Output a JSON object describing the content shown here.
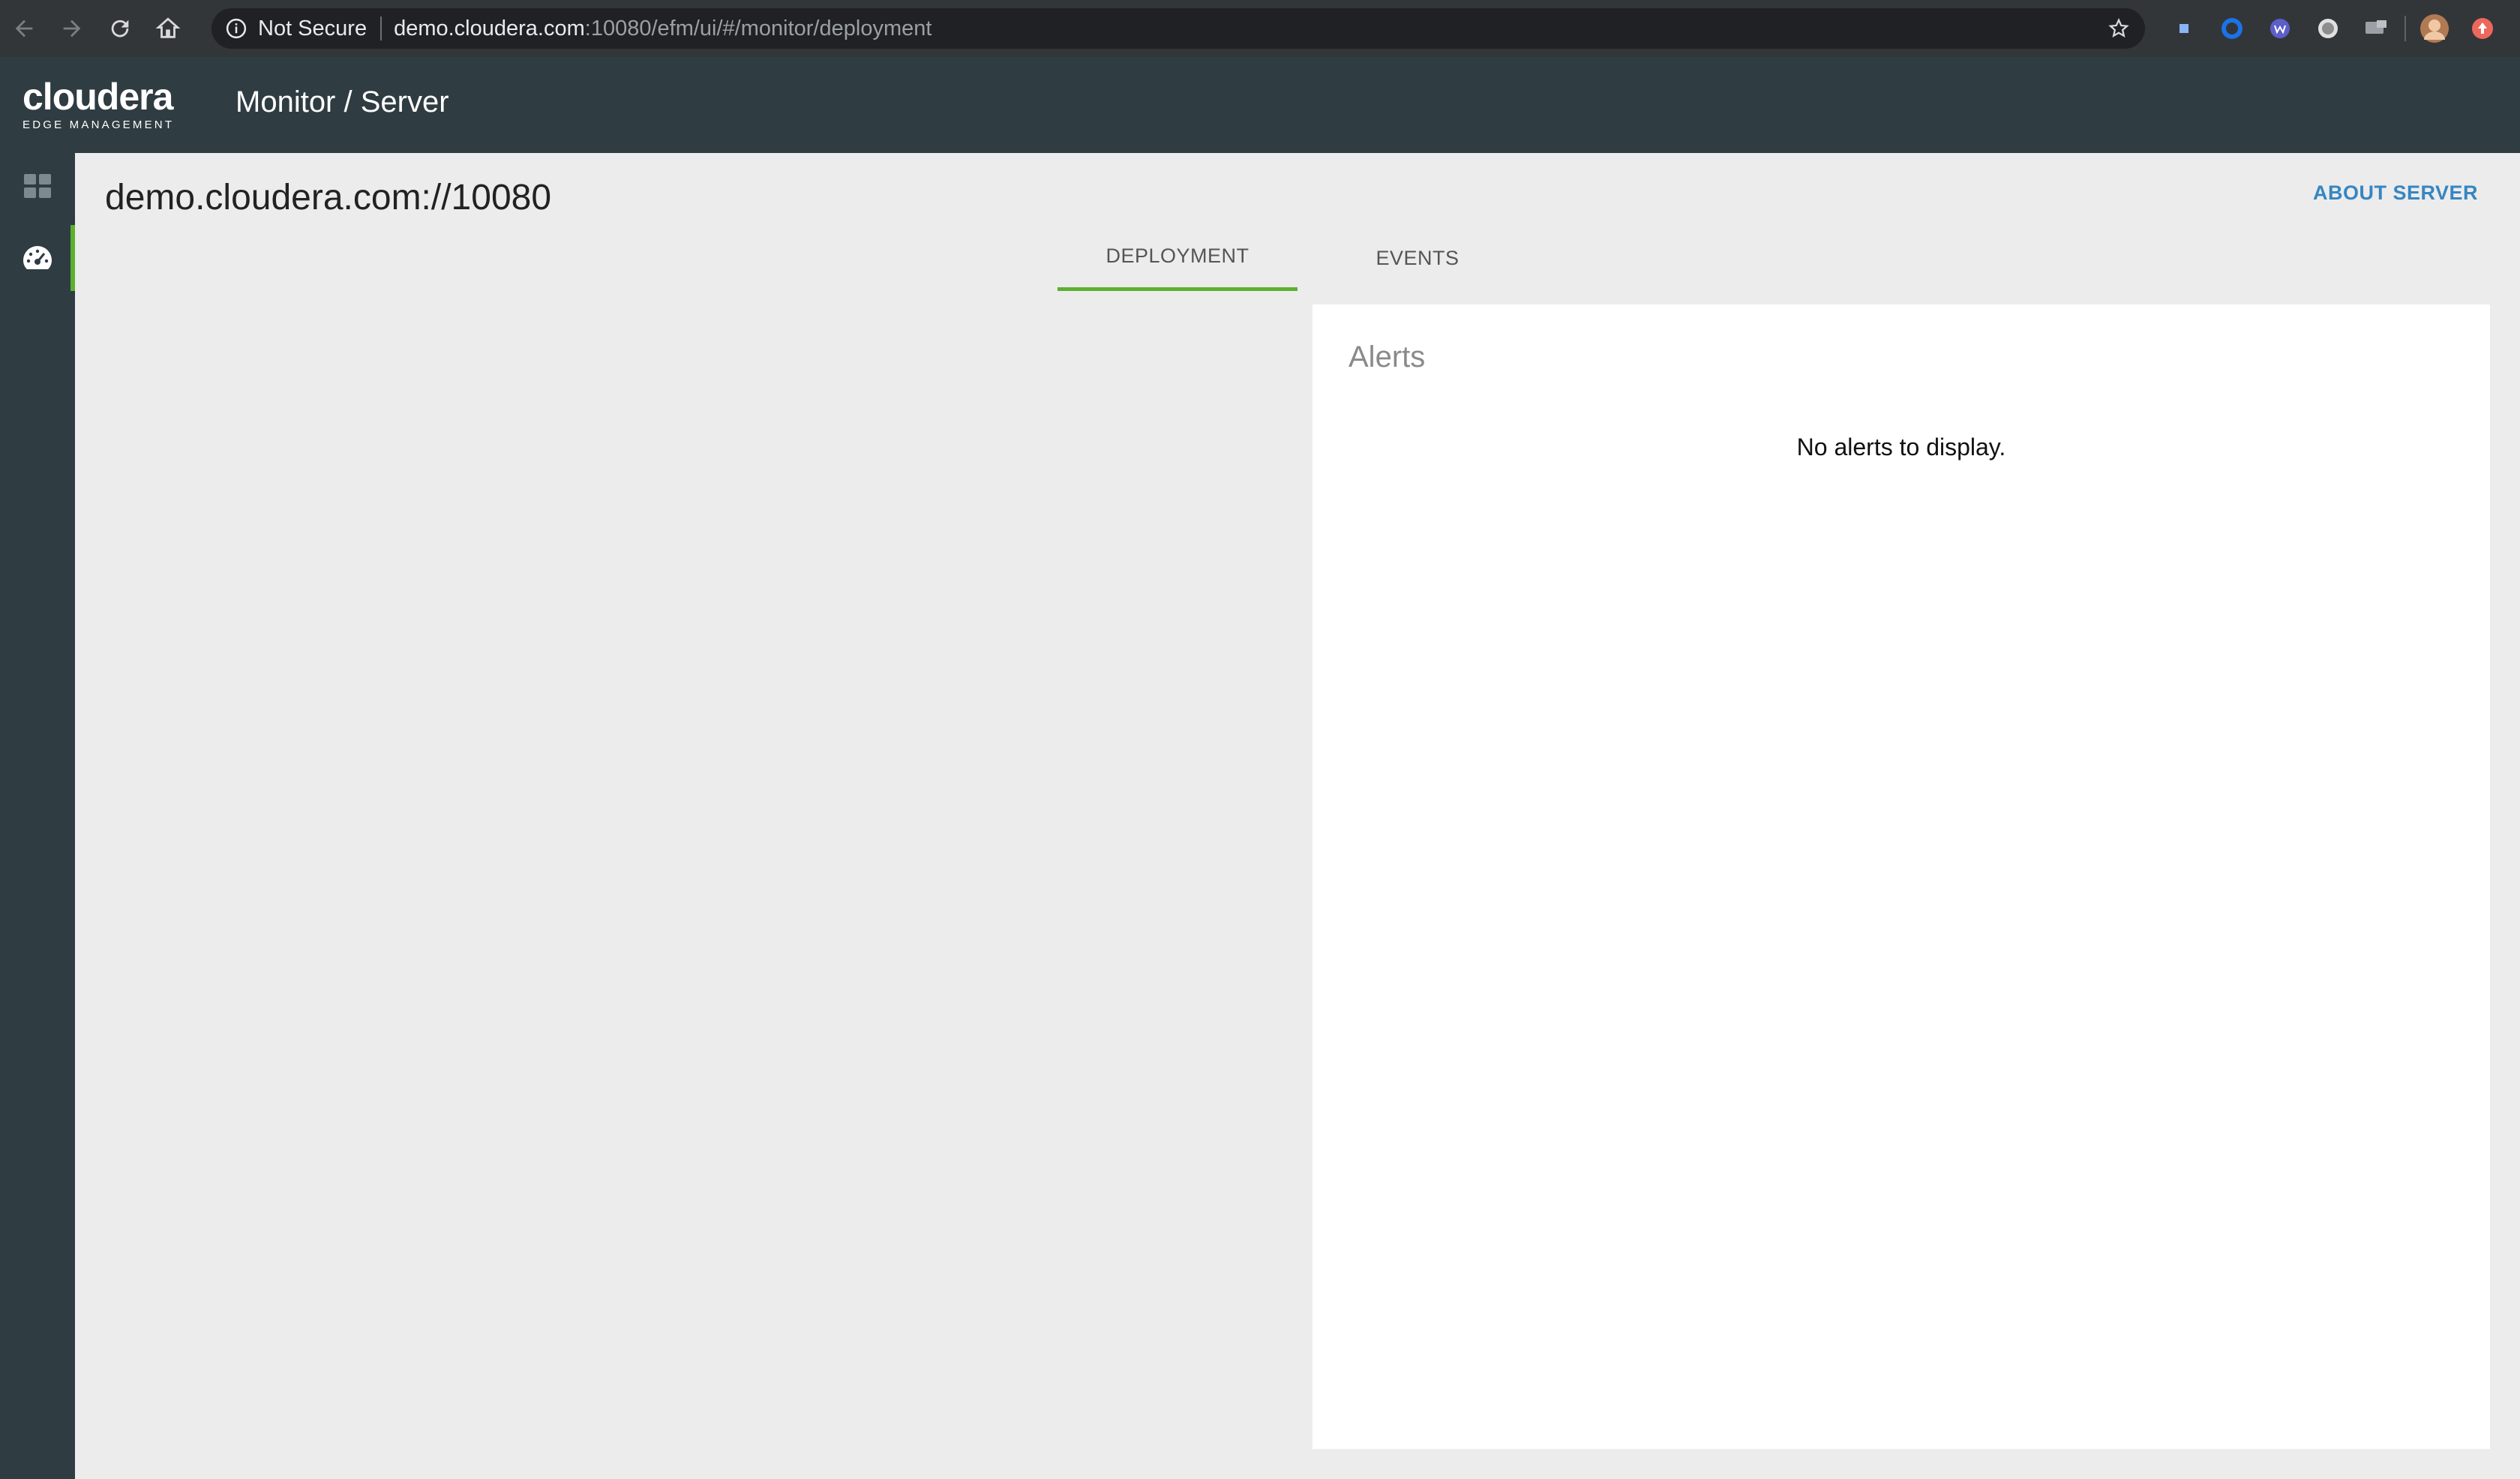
{
  "browser": {
    "security_label": "Not Secure",
    "url_host": "demo.cloudera.com",
    "url_rest": ":10080/efm/ui/#/monitor/deployment",
    "nav_icons": [
      "back-arrow-icon",
      "forward-arrow-icon",
      "reload-icon",
      "home-icon"
    ],
    "extension_icons": [
      "extension-square-icon",
      "extension-circle-icon",
      "extension-w-icon",
      "extension-disc-icon",
      "extension-cast-icon"
    ]
  },
  "app": {
    "logo_main": "cloudera",
    "logo_sub": "EDGE MANAGEMENT",
    "page_title": "Monitor / Server",
    "accent_color": "#5cb030",
    "header_color": "#2f3c42",
    "link_color": "#3686c1"
  },
  "sidebar": {
    "items": [
      {
        "icon": "dashboard-grid-icon",
        "active": false
      },
      {
        "icon": "monitor-gauge-icon",
        "active": true
      }
    ]
  },
  "main": {
    "server_title": "demo.cloudera.com://10080",
    "about_link": "ABOUT SERVER",
    "tabs": [
      {
        "label": "DEPLOYMENT",
        "active": true
      },
      {
        "label": "EVENTS",
        "active": false
      }
    ],
    "alerts": {
      "title": "Alerts",
      "empty_message": "No alerts to display."
    }
  }
}
